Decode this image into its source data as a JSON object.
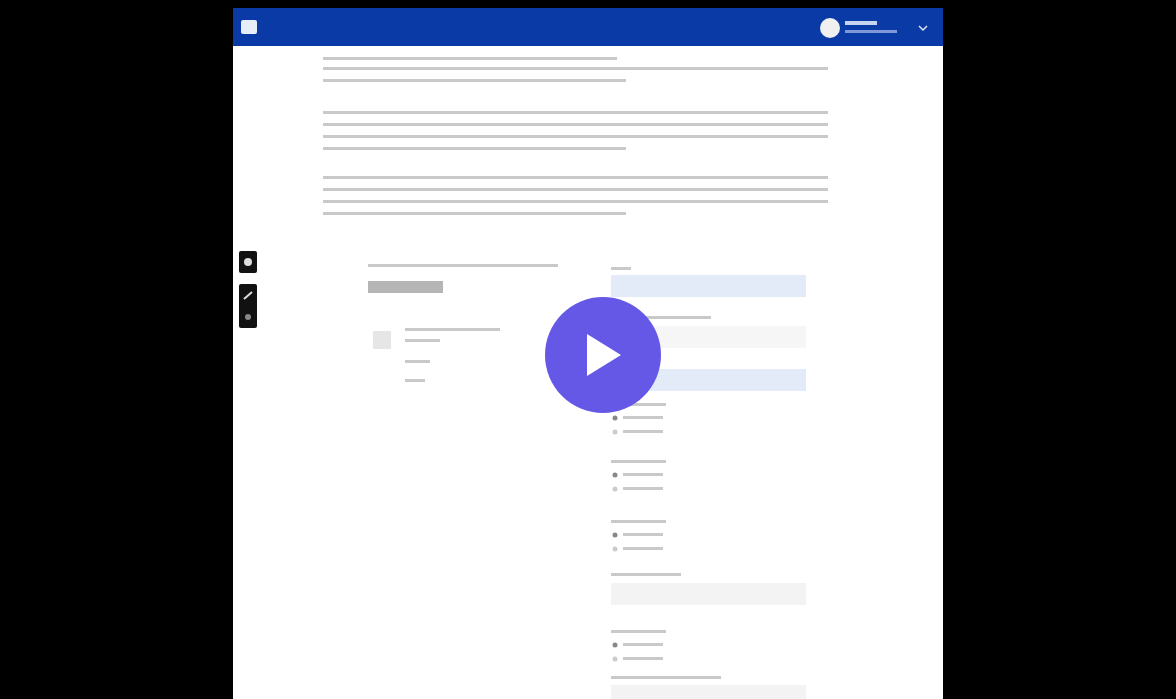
{
  "video": {
    "playing": false
  }
}
